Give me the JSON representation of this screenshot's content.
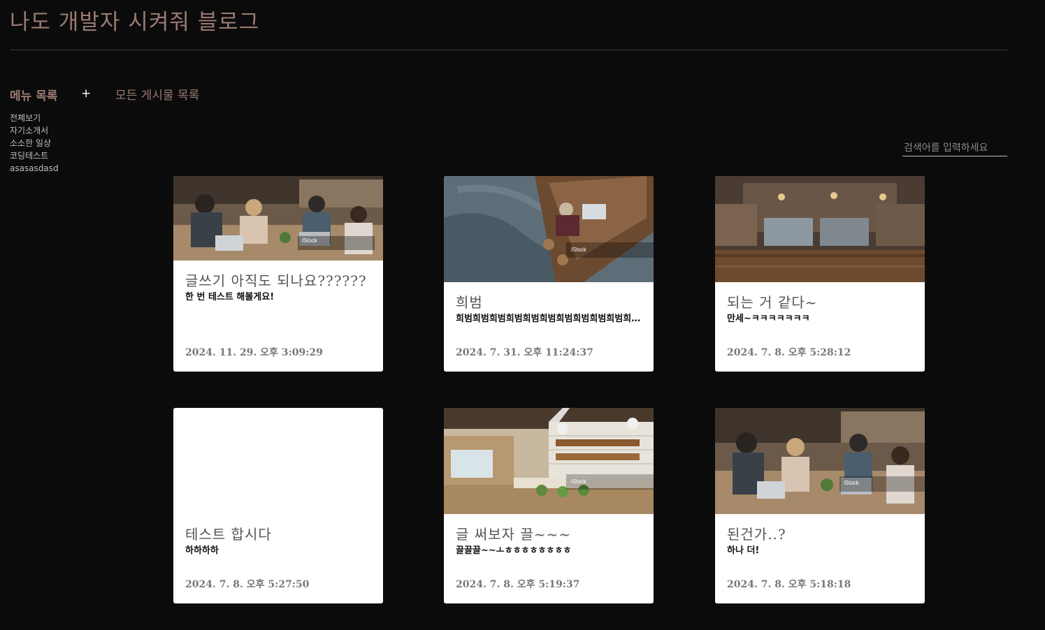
{
  "blog": {
    "title": "나도 개발자 시켜줘 블로그"
  },
  "sidebar": {
    "title": "메뉴 목록",
    "add_label": "+",
    "items": [
      {
        "label": "전체보기"
      },
      {
        "label": "자기소개서"
      },
      {
        "label": "소소한 일상"
      },
      {
        "label": "코딩테스트"
      },
      {
        "label": "asasasdasd"
      }
    ]
  },
  "main": {
    "title": "모든 게시물 목록"
  },
  "search": {
    "placeholder": "검색어를 입력하세요"
  },
  "posts": [
    {
      "title": "글쓰기 아직도 되나요??????",
      "excerpt": "한 번 테스트 해볼게요!",
      "date": "2024. 11. 29. 오후 3:09:29",
      "has_image": true,
      "image_caption": "iStock"
    },
    {
      "title": "희범",
      "excerpt": "희범희범희범희범희범희범희범희범희범희범희범희범희범희범희범희범",
      "date": "2024. 7. 31. 오후 11:24:37",
      "has_image": true,
      "image_caption": "iStock"
    },
    {
      "title": "되는 거 같다~",
      "excerpt": "만세~ㅋㅋㅋㅋㅋㅋㅋ",
      "date": "2024. 7. 8. 오후 5:28:12",
      "has_image": true,
      "image_caption": ""
    },
    {
      "title": "테스트 합시다",
      "excerpt": "하하하하",
      "date": "2024. 7. 8. 오후 5:27:50",
      "has_image": false,
      "image_caption": ""
    },
    {
      "title": "글 써보자 끌~~~",
      "excerpt": "끌끌끌~~ㅗㅎㅎㅎㅎㅎㅎㅎㅎ",
      "date": "2024. 7. 8. 오후 5:19:37",
      "has_image": true,
      "image_caption": "iStock"
    },
    {
      "title": "된건가..?",
      "excerpt": "하나 더!",
      "date": "2024. 7. 8. 오후 5:18:18",
      "has_image": true,
      "image_caption": "iStock"
    }
  ],
  "colors": {
    "background": "#0b0b0b",
    "accent": "#9a7a72",
    "card": "#ffffff"
  }
}
